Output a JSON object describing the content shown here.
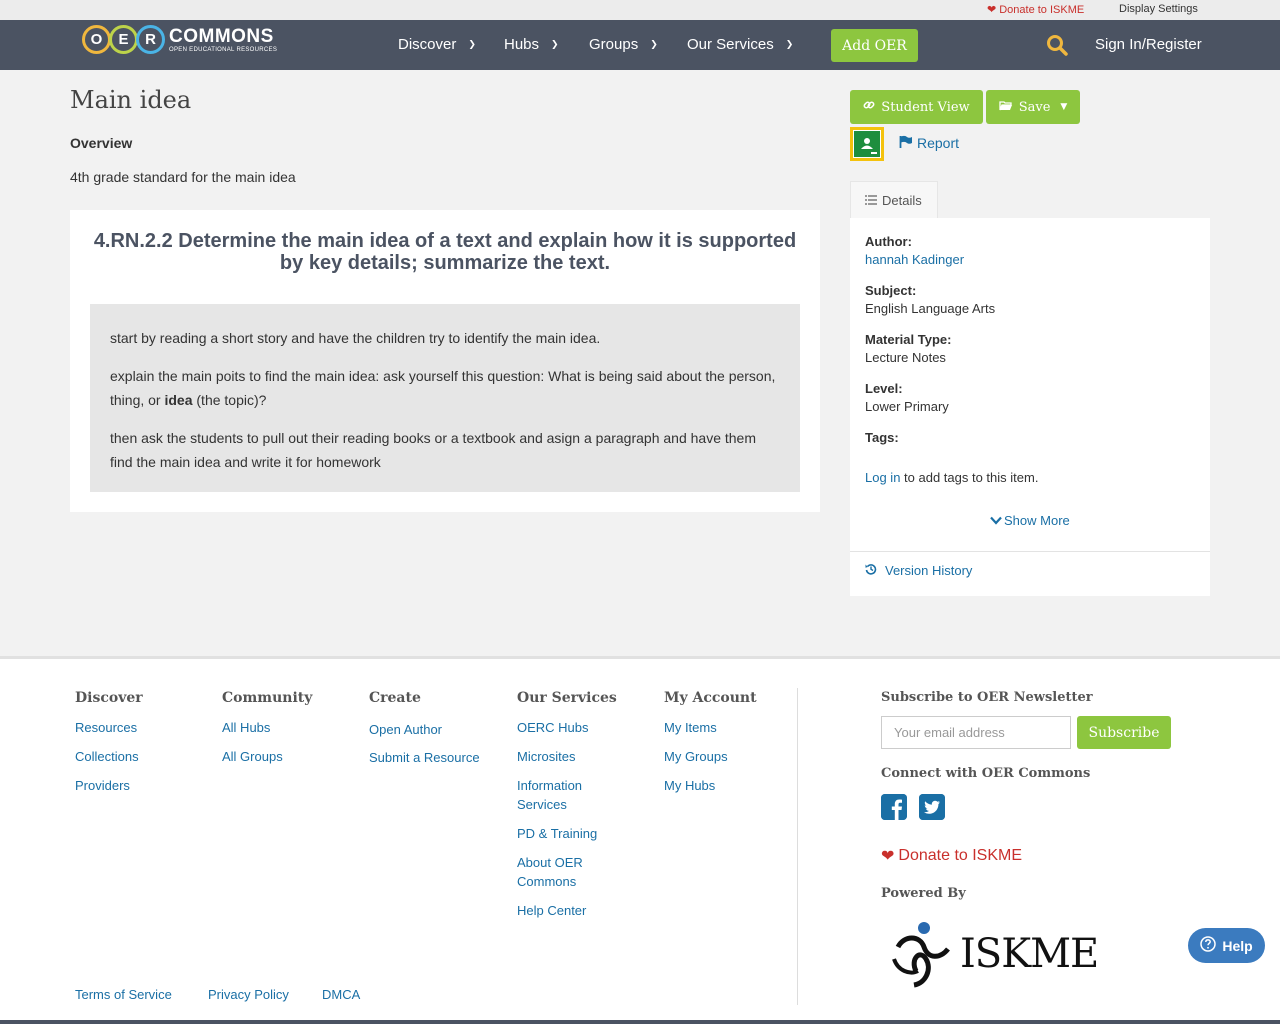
{
  "utility_bar": {
    "donate": "Donate to ISKME",
    "display_settings": "Display Settings"
  },
  "header": {
    "logo_letters": [
      "O",
      "E",
      "R"
    ],
    "logo_word": "COMMONS",
    "logo_sub": "OPEN EDUCATIONAL RESOURCES",
    "nav": [
      "Discover",
      "Hubs",
      "Groups",
      "Our Services"
    ],
    "add_oer": "Add OER",
    "sign_in": "Sign In/Register"
  },
  "main": {
    "title": "Main idea",
    "overview_heading": "Overview",
    "overview_text": "4th grade standard for the main idea",
    "lesson_heading": "4.RN.2.2 Determine the main idea of a text and explain how it is supported by key details; summarize the text.",
    "para1": "start by reading a short story and have the children try to identify the main idea.",
    "para2_before": "explain the main poits to find the main idea: ask yourself this question: What is being said about the person, thing, or ",
    "para2_bold": "idea",
    "para2_after": " (the topic)?",
    "para3": "then ask the students to pull out their reading books or a textbook and asign a paragraph and have them find the main idea and write it for homework"
  },
  "sidebar": {
    "student_view": "Student View",
    "save": "Save",
    "report": "Report",
    "details_tab": "Details",
    "author_label": "Author:",
    "author_value": "hannah Kadinger",
    "subject_label": "Subject:",
    "subject_value": "English Language Arts",
    "material_label": "Material Type:",
    "material_value": "Lecture Notes",
    "level_label": "Level:",
    "level_value": "Lower Primary",
    "tags_label": "Tags:",
    "login_link": "Log in",
    "login_suffix": " to add tags to this item.",
    "show_more": "Show More",
    "version_history": "Version History"
  },
  "footer": {
    "discover": {
      "heading": "Discover",
      "links": [
        "Resources",
        "Collections",
        "Providers"
      ]
    },
    "community": {
      "heading": "Community",
      "links": [
        "All Hubs",
        "All Groups"
      ]
    },
    "create": {
      "heading": "Create",
      "links": [
        "Open Author",
        "Submit a Resource"
      ]
    },
    "services": {
      "heading": "Our Services",
      "links": [
        "OERC Hubs",
        "Microsites",
        "Information Services",
        "PD & Training",
        "About OER Commons",
        "Help Center"
      ]
    },
    "account": {
      "heading": "My Account",
      "links": [
        "My Items",
        "My Groups",
        "My Hubs"
      ]
    },
    "newsletter_heading": "Subscribe to OER Newsletter",
    "email_placeholder": "Your email address",
    "subscribe": "Subscribe",
    "connect_heading": "Connect with OER Commons",
    "donate": "Donate to ISKME",
    "powered_by": "Powered By",
    "iskme_logo": "ISKME",
    "legal": [
      "Terms of Service",
      "Privacy Policy",
      "DMCA"
    ]
  },
  "help_button": "Help",
  "colors": {
    "nav_bg": "#4b5362",
    "accent_green": "#8dc63f",
    "link_blue": "#1a6fa5",
    "donate_red": "#c9302c"
  }
}
